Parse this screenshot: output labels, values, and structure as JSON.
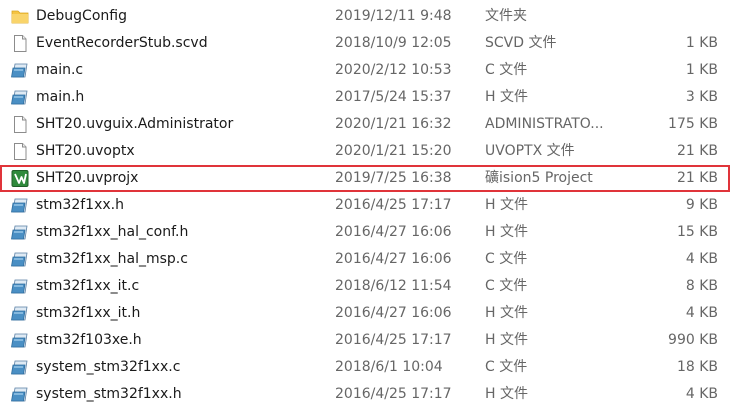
{
  "files": [
    {
      "name": "DebugConfig",
      "date": "2019/12/11 9:48",
      "type": "文件夹",
      "size": "",
      "icon": "folder-icon"
    },
    {
      "name": "EventRecorderStub.scvd",
      "date": "2018/10/9 12:05",
      "type": "SCVD 文件",
      "size": "1 KB",
      "icon": "blank-file-icon"
    },
    {
      "name": "main.c",
      "date": "2020/2/12 10:53",
      "type": "C 文件",
      "size": "1 KB",
      "icon": "source-file-icon"
    },
    {
      "name": "main.h",
      "date": "2017/5/24 15:37",
      "type": "H 文件",
      "size": "3 KB",
      "icon": "source-file-icon"
    },
    {
      "name": "SHT20.uvguix.Administrator",
      "date": "2020/1/21 16:32",
      "type": "ADMINISTRATO...",
      "size": "175 KB",
      "icon": "blank-file-icon"
    },
    {
      "name": "SHT20.uvoptx",
      "date": "2020/1/21 15:20",
      "type": "UVOPTX 文件",
      "size": "21 KB",
      "icon": "blank-file-icon"
    },
    {
      "name": "SHT20.uvprojx",
      "date": "2019/7/25 16:38",
      "type": "礦ision5 Project",
      "size": "21 KB",
      "icon": "keil-project-icon",
      "selected": true
    },
    {
      "name": "stm32f1xx.h",
      "date": "2016/4/25 17:17",
      "type": "H 文件",
      "size": "9 KB",
      "icon": "source-file-icon"
    },
    {
      "name": "stm32f1xx_hal_conf.h",
      "date": "2016/4/27 16:06",
      "type": "H 文件",
      "size": "15 KB",
      "icon": "source-file-icon"
    },
    {
      "name": "stm32f1xx_hal_msp.c",
      "date": "2016/4/27 16:06",
      "type": "C 文件",
      "size": "4 KB",
      "icon": "source-file-icon"
    },
    {
      "name": "stm32f1xx_it.c",
      "date": "2018/6/12 11:54",
      "type": "C 文件",
      "size": "8 KB",
      "icon": "source-file-icon"
    },
    {
      "name": "stm32f1xx_it.h",
      "date": "2016/4/27 16:06",
      "type": "H 文件",
      "size": "4 KB",
      "icon": "source-file-icon"
    },
    {
      "name": "stm32f103xe.h",
      "date": "2016/4/25 17:17",
      "type": "H 文件",
      "size": "990 KB",
      "icon": "source-file-icon"
    },
    {
      "name": "system_stm32f1xx.c",
      "date": "2018/6/1 10:04",
      "type": "C 文件",
      "size": "18 KB",
      "icon": "source-file-icon"
    },
    {
      "name": "system_stm32f1xx.h",
      "date": "2016/4/25 17:17",
      "type": "H 文件",
      "size": "4 KB",
      "icon": "source-file-icon"
    }
  ],
  "colors": {
    "selection_outline": "#e0343a",
    "secondary_text": "#666666",
    "folder": "#f5c443",
    "source_icon": "#4a8fc4",
    "keil_icon": "#2f8a3c"
  }
}
